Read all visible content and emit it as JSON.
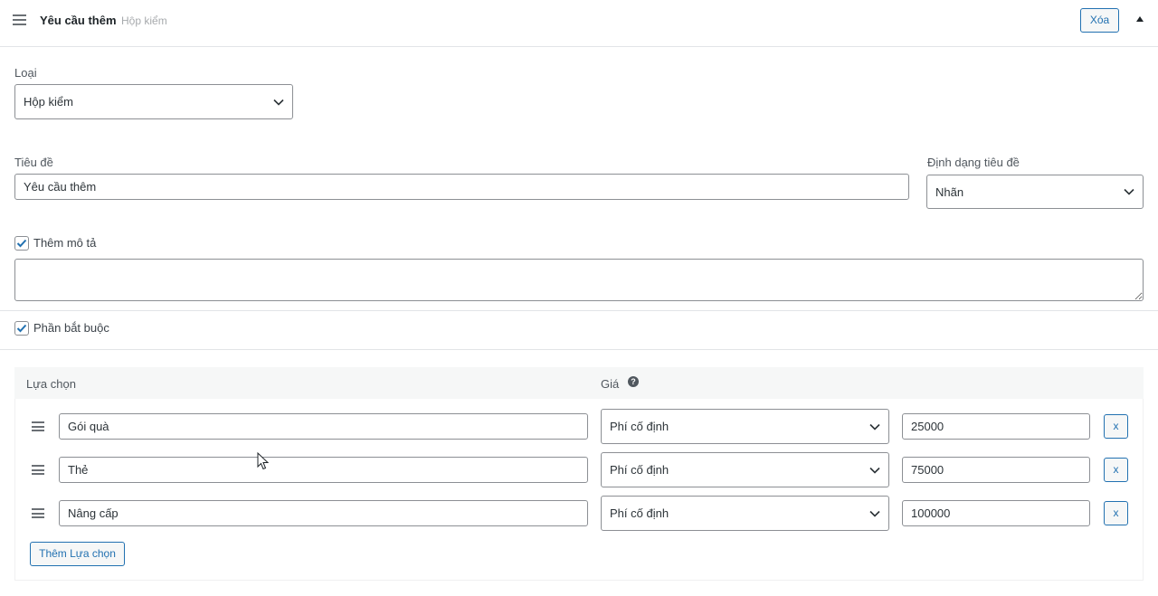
{
  "header": {
    "title": "Yêu cầu thêm",
    "subtitle": "Hộp kiểm",
    "delete_label": "Xóa"
  },
  "type_field": {
    "label": "Loại",
    "value": "Hộp kiểm"
  },
  "title_field": {
    "label": "Tiêu đề",
    "value": "Yêu cầu thêm"
  },
  "title_format": {
    "label": "Định dạng tiêu đề",
    "value": "Nhãn"
  },
  "add_description": {
    "label": "Thêm mô tả",
    "checked": true,
    "value": ""
  },
  "required": {
    "label": "Phần bắt buộc",
    "checked": true
  },
  "options": {
    "col_choice": "Lựa chọn",
    "col_price": "Giá",
    "help_glyph": "?",
    "rows": [
      {
        "name": "Gói quà",
        "price_type": "Phí cố định",
        "price": "25000",
        "remove": "x"
      },
      {
        "name": "Thẻ",
        "price_type": "Phí cố định",
        "price": "75000",
        "remove": "x"
      },
      {
        "name": "Nâng cấp",
        "price_type": "Phí cố định",
        "price": "100000",
        "remove": "x"
      }
    ],
    "add_label": "Thêm Lựa chọn"
  },
  "colors": {
    "accent": "#2271b1",
    "border": "#8c8f94",
    "text": "#1d2327"
  }
}
